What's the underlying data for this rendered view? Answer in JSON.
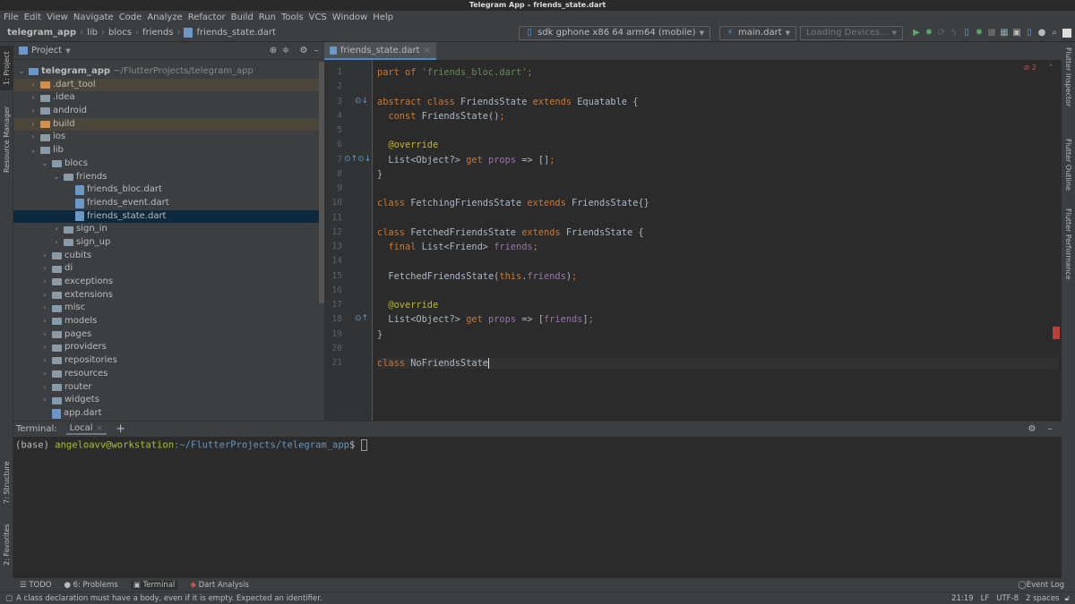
{
  "window": {
    "title": "Telegram App – friends_state.dart"
  },
  "menu": [
    "File",
    "Edit",
    "View",
    "Navigate",
    "Code",
    "Analyze",
    "Refactor",
    "Build",
    "Run",
    "Tools",
    "VCS",
    "Window",
    "Help"
  ],
  "breadcrumb": [
    "telegram_app",
    "lib",
    "blocs",
    "friends",
    "friends_state.dart"
  ],
  "toolbar": {
    "device": "sdk gphone x86 64 arm64 (mobile)",
    "run_config": "main.dart",
    "loading": "Loading Devices..."
  },
  "left_stripe": [
    "1: Project",
    "Resource Manager",
    "7: Structure",
    "2: Favorites"
  ],
  "right_stripe": [
    "Flutter Inspector",
    "Flutter Outline",
    "Flutter Performance"
  ],
  "project": {
    "title": "Project",
    "tree": [
      {
        "label": "telegram_app",
        "suffix": "~/FlutterProjects/telegram_app",
        "level": 0,
        "type": "module",
        "open": true
      },
      {
        "label": ".dart_tool",
        "level": 1,
        "type": "folder-orange",
        "excl": true
      },
      {
        "label": ".idea",
        "level": 1,
        "type": "folder"
      },
      {
        "label": "android",
        "level": 1,
        "type": "folder"
      },
      {
        "label": "build",
        "level": 1,
        "type": "folder-orange",
        "excl": true
      },
      {
        "label": "ios",
        "level": 1,
        "type": "folder"
      },
      {
        "label": "lib",
        "level": 1,
        "type": "folder",
        "open": true
      },
      {
        "label": "blocs",
        "level": 2,
        "type": "folder",
        "open": true
      },
      {
        "label": "friends",
        "level": 3,
        "type": "folder",
        "open": true
      },
      {
        "label": "friends_bloc.dart",
        "level": 4,
        "type": "file"
      },
      {
        "label": "friends_event.dart",
        "level": 4,
        "type": "file"
      },
      {
        "label": "friends_state.dart",
        "level": 4,
        "type": "file",
        "selected": true
      },
      {
        "label": "sign_in",
        "level": 3,
        "type": "folder"
      },
      {
        "label": "sign_up",
        "level": 3,
        "type": "folder"
      },
      {
        "label": "cubits",
        "level": 2,
        "type": "folder"
      },
      {
        "label": "di",
        "level": 2,
        "type": "folder"
      },
      {
        "label": "exceptions",
        "level": 2,
        "type": "folder"
      },
      {
        "label": "extensions",
        "level": 2,
        "type": "folder"
      },
      {
        "label": "misc",
        "level": 2,
        "type": "folder"
      },
      {
        "label": "models",
        "level": 2,
        "type": "folder"
      },
      {
        "label": "pages",
        "level": 2,
        "type": "folder"
      },
      {
        "label": "providers",
        "level": 2,
        "type": "folder"
      },
      {
        "label": "repositories",
        "level": 2,
        "type": "folder"
      },
      {
        "label": "resources",
        "level": 2,
        "type": "folder"
      },
      {
        "label": "router",
        "level": 2,
        "type": "folder"
      },
      {
        "label": "widgets",
        "level": 2,
        "type": "folder"
      },
      {
        "label": "app.dart",
        "level": 2,
        "type": "file"
      }
    ]
  },
  "editor": {
    "tab": "friends_state.dart",
    "error_count": "2",
    "lines": [
      [
        [
          "k",
          "part of "
        ],
        [
          "s",
          "'friends_bloc.dart'"
        ],
        [
          "k",
          ";"
        ]
      ],
      [],
      [
        [
          "k",
          "abstract class "
        ],
        [
          "",
          "FriendsState "
        ],
        [
          "k",
          "extends "
        ],
        [
          "",
          "Equatable {"
        ]
      ],
      [
        [
          "",
          "  "
        ],
        [
          "k",
          "const "
        ],
        [
          "",
          "FriendsState()"
        ],
        [
          "k",
          ";"
        ]
      ],
      [],
      [
        [
          "a",
          "  @override"
        ]
      ],
      [
        [
          "",
          "  List<Object?> "
        ],
        [
          "k",
          "get "
        ],
        [
          "p",
          "props"
        ],
        [
          "",
          " => []"
        ],
        [
          "k",
          ";"
        ]
      ],
      [
        [
          "",
          "}"
        ]
      ],
      [],
      [
        [
          "k",
          "class "
        ],
        [
          "",
          "FetchingFriendsState "
        ],
        [
          "k",
          "extends "
        ],
        [
          "",
          "FriendsState{}"
        ]
      ],
      [],
      [
        [
          "k",
          "class "
        ],
        [
          "",
          "FetchedFriendsState "
        ],
        [
          "k",
          "extends "
        ],
        [
          "",
          "FriendsState {"
        ]
      ],
      [
        [
          "",
          "  "
        ],
        [
          "k",
          "final "
        ],
        [
          "",
          "List<Friend> "
        ],
        [
          "p",
          "friends"
        ],
        [
          "k",
          ";"
        ]
      ],
      [],
      [
        [
          "",
          "  FetchedFriendsState("
        ],
        [
          "k",
          "this"
        ],
        [
          "",
          "."
        ],
        [
          "p",
          "friends"
        ],
        [
          "",
          ")"
        ],
        [
          "k",
          ";"
        ]
      ],
      [],
      [
        [
          "a",
          "  @override"
        ]
      ],
      [
        [
          "",
          "  List<Object?> "
        ],
        [
          "k",
          "get "
        ],
        [
          "p",
          "props"
        ],
        [
          "",
          " => ["
        ],
        [
          "p",
          "friends"
        ],
        [
          "",
          "]"
        ],
        [
          "k",
          ";"
        ]
      ],
      [
        [
          "",
          "}"
        ]
      ],
      [],
      [
        [
          "k",
          "class "
        ],
        [
          "",
          "NoFriendsState"
        ]
      ]
    ]
  },
  "terminal": {
    "label": "Terminal:",
    "tab": "Local",
    "prefix": "(base) ",
    "user": "angeloavv@workstation",
    "path": ":~/FlutterProjects/telegram_app",
    "prompt": "$"
  },
  "bottom_tools": [
    "TODO",
    "6: Problems",
    "Terminal",
    "Dart Analysis"
  ],
  "event_log": "Event Log",
  "status": {
    "message": "A class declaration must have a body, even if it is empty. Expected an identifier.",
    "position": "21:19",
    "line_sep": "LF",
    "encoding": "UTF-8",
    "indent": "2 spaces"
  }
}
